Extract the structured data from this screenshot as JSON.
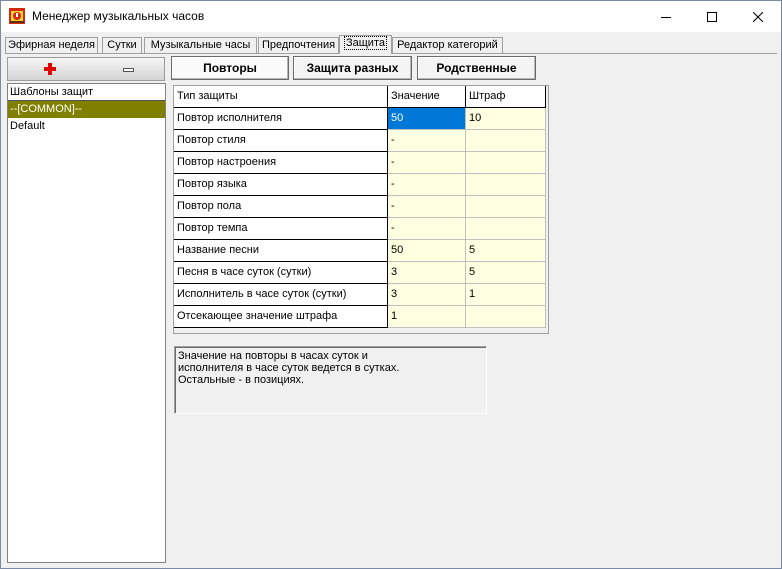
{
  "window": {
    "title": "Менеджер музыкальных часов",
    "icon": "app-clock-icon",
    "controls": [
      "minimize-icon",
      "maximize-icon",
      "close-icon"
    ]
  },
  "tabs": [
    {
      "label": "Эфирная неделя",
      "active": false
    },
    {
      "label": "Сутки",
      "active": false
    },
    {
      "label": "Музыкальные часы",
      "active": false
    },
    {
      "label": "Предпочтения",
      "active": false
    },
    {
      "label": "Защита",
      "active": true
    },
    {
      "label": "Редактор категорий",
      "active": false
    }
  ],
  "left_panel": {
    "add_icon": "plus-icon",
    "remove_icon": "minus-icon",
    "header": "Шаблоны защит",
    "items": [
      {
        "label": "--[COMMON]--",
        "selected": true
      },
      {
        "label": "Default",
        "selected": false
      }
    ]
  },
  "buttons": {
    "repeats": "Повторы",
    "separation": "Защита разных",
    "related": "Родственные"
  },
  "grid": {
    "columns": [
      "Тип защиты",
      "Значение",
      "Штраф"
    ],
    "rows": [
      {
        "type": "Повтор исполнителя",
        "value": "50",
        "penalty": "10"
      },
      {
        "type": "Повтор стиля",
        "value": "-",
        "penalty": ""
      },
      {
        "type": "Повтор настроения",
        "value": "-",
        "penalty": ""
      },
      {
        "type": "Повтор языка",
        "value": "-",
        "penalty": ""
      },
      {
        "type": "Повтор пола",
        "value": "-",
        "penalty": ""
      },
      {
        "type": "Повтор темпа",
        "value": "-",
        "penalty": ""
      },
      {
        "type": "Название песни",
        "value": "50",
        "penalty": "5"
      },
      {
        "type": "Песня в часе суток (сутки)",
        "value": "3",
        "penalty": "5"
      },
      {
        "type": "Исполнитель в часе суток (сутки)",
        "value": "3",
        "penalty": "1"
      },
      {
        "type": "Отсекающее значение штрафа",
        "value": "1",
        "penalty": ""
      }
    ],
    "selected_cell": "row0-value"
  },
  "note": "Значение на повторы в часах суток и\nисполнителя в часе суток ведется в сутках.\nОстальные - в позициях.",
  "colors": {
    "selection_olive": "#808000",
    "cell_highlight": "#0078d7",
    "cell_background": "#ffffe1"
  }
}
